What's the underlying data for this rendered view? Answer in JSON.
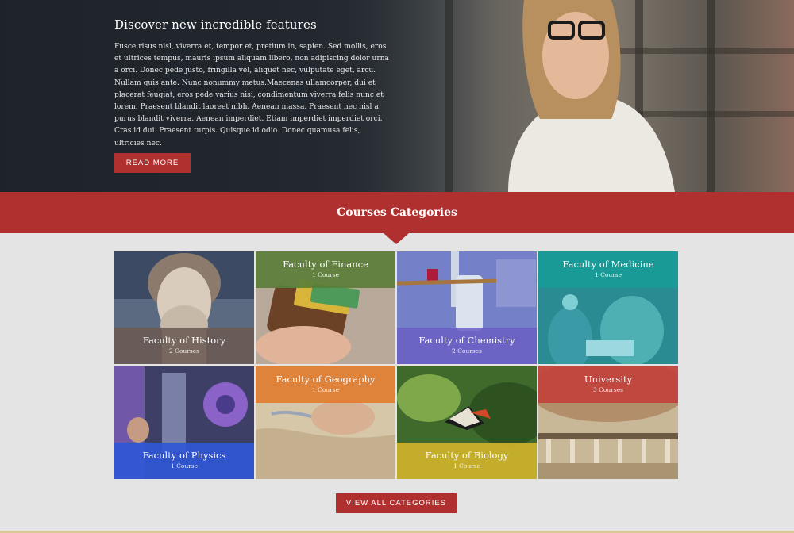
{
  "hero": {
    "title": "Discover new incredible features",
    "body": "Fusce risus nisl, viverra et, tempor et, pretium in, sapien. Sed mollis, eros et ultrices tempus, mauris ipsum aliquam libero, non adipiscing dolor urna a orci. Donec pede justo, fringilla vel, aliquet nec, vulputate eget, arcu. Nullam quis ante. Nunc nonummy metus.Maecenas ullamcorper, dui et placerat feugiat, eros pede varius nisi, condimentum viverra felis nunc et lorem. Praesent blandit laoreet nibh. Aenean massa. Praesent nec nisl a purus blandit viverra. Aenean imperdiet. Etiam imperdiet imperdiet orci. Cras id dui. Praesent turpis. Quisque id odio. Donec quamusa felis, ultricies nec.",
    "button_label": "READ MORE"
  },
  "section": {
    "title": "Courses Categories"
  },
  "categories": [
    {
      "name": "Faculty of History",
      "count": "2 Courses",
      "color": "#6b5a52"
    },
    {
      "name": "Faculty of Finance",
      "count": "1 Course",
      "color": "#5b7f3a"
    },
    {
      "name": "Faculty of Chemistry",
      "count": "2 Courses",
      "color": "#6a5fc4"
    },
    {
      "name": "Faculty of Medicine",
      "count": "1 Course",
      "color": "#1aa09a"
    },
    {
      "name": "Faculty of Physics",
      "count": "1 Course",
      "color": "#2f57d6"
    },
    {
      "name": "Faculty of Geography",
      "count": "1 Course",
      "color": "#e07a2e"
    },
    {
      "name": "Faculty of Biology",
      "count": "1 Course",
      "color": "#d1b52a"
    },
    {
      "name": "University",
      "count": "3 Courses",
      "color": "#c1403a"
    }
  ],
  "footer": {
    "button_label": "VIEW ALL CATEGORIES"
  },
  "colors": {
    "accent": "#b0302f",
    "background": "#e4e4e4"
  }
}
